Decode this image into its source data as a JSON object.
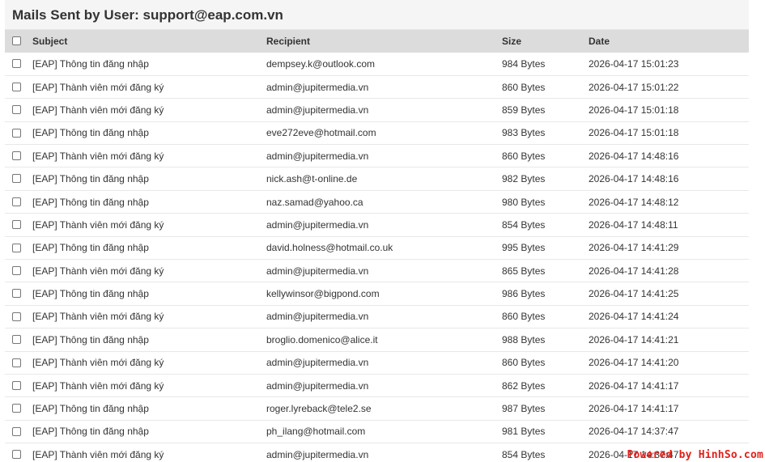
{
  "panel": {
    "title": "Mails Sent by User: support@eap.com.vn"
  },
  "table": {
    "columns": [
      "Subject",
      "Recipient",
      "Size",
      "Date"
    ],
    "rows": [
      {
        "subject": "[EAP] Thông tin đăng nhập",
        "recipient": "dempsey.k@outlook.com",
        "size": "984 Bytes",
        "date": "2026-04-17 15:01:23"
      },
      {
        "subject": "[EAP] Thành viên mới đăng ký",
        "recipient": "admin@jupitermedia.vn",
        "size": "860 Bytes",
        "date": "2026-04-17 15:01:22"
      },
      {
        "subject": "[EAP] Thành viên mới đăng ký",
        "recipient": "admin@jupitermedia.vn",
        "size": "859 Bytes",
        "date": "2026-04-17 15:01:18"
      },
      {
        "subject": "[EAP] Thông tin đăng nhập",
        "recipient": "eve272eve@hotmail.com",
        "size": "983 Bytes",
        "date": "2026-04-17 15:01:18"
      },
      {
        "subject": "[EAP] Thành viên mới đăng ký",
        "recipient": "admin@jupitermedia.vn",
        "size": "860 Bytes",
        "date": "2026-04-17 14:48:16"
      },
      {
        "subject": "[EAP] Thông tin đăng nhập",
        "recipient": "nick.ash@t-online.de",
        "size": "982 Bytes",
        "date": "2026-04-17 14:48:16"
      },
      {
        "subject": "[EAP] Thông tin đăng nhập",
        "recipient": "naz.samad@yahoo.ca",
        "size": "980 Bytes",
        "date": "2026-04-17 14:48:12"
      },
      {
        "subject": "[EAP] Thành viên mới đăng ký",
        "recipient": "admin@jupitermedia.vn",
        "size": "854 Bytes",
        "date": "2026-04-17 14:48:11"
      },
      {
        "subject": "[EAP] Thông tin đăng nhập",
        "recipient": "david.holness@hotmail.co.uk",
        "size": "995 Bytes",
        "date": "2026-04-17 14:41:29"
      },
      {
        "subject": "[EAP] Thành viên mới đăng ký",
        "recipient": "admin@jupitermedia.vn",
        "size": "865 Bytes",
        "date": "2026-04-17 14:41:28"
      },
      {
        "subject": "[EAP] Thông tin đăng nhập",
        "recipient": "kellywinsor@bigpond.com",
        "size": "986 Bytes",
        "date": "2026-04-17 14:41:25"
      },
      {
        "subject": "[EAP] Thành viên mới đăng ký",
        "recipient": "admin@jupitermedia.vn",
        "size": "860 Bytes",
        "date": "2026-04-17 14:41:24"
      },
      {
        "subject": "[EAP] Thông tin đăng nhập",
        "recipient": "broglio.domenico@alice.it",
        "size": "988 Bytes",
        "date": "2026-04-17 14:41:21"
      },
      {
        "subject": "[EAP] Thành viên mới đăng ký",
        "recipient": "admin@jupitermedia.vn",
        "size": "860 Bytes",
        "date": "2026-04-17 14:41:20"
      },
      {
        "subject": "[EAP] Thành viên mới đăng ký",
        "recipient": "admin@jupitermedia.vn",
        "size": "862 Bytes",
        "date": "2026-04-17 14:41:17"
      },
      {
        "subject": "[EAP] Thông tin đăng nhập",
        "recipient": "roger.lyreback@tele2.se",
        "size": "987 Bytes",
        "date": "2026-04-17 14:41:17"
      },
      {
        "subject": "[EAP] Thông tin đăng nhập",
        "recipient": "ph_ilang@hotmail.com",
        "size": "981 Bytes",
        "date": "2026-04-17 14:37:47"
      },
      {
        "subject": "[EAP] Thành viên mới đăng ký",
        "recipient": "admin@jupitermedia.vn",
        "size": "854 Bytes",
        "date": "2026-04-17 14:37:47"
      }
    ]
  },
  "watermark": {
    "text": "Powered by HinhSo.com"
  },
  "colors": {
    "header_bg": "#f5f5f5",
    "table_head_bg": "#dcdcdc",
    "watermark": "#e0201b"
  },
  "icons": {
    "select_all": "checkbox-icon",
    "row_select": "checkbox-icon"
  }
}
